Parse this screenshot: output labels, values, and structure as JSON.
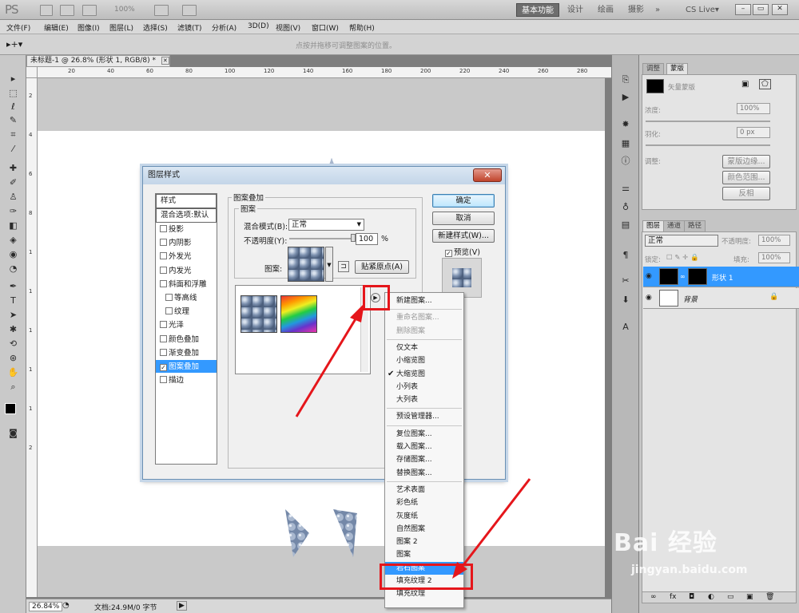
{
  "app": {
    "logo": "PS",
    "zoom": "100%",
    "workspaces": [
      "基本功能",
      "设计",
      "绘画",
      "摄影"
    ],
    "more": "»",
    "cslive": "CS Live▾",
    "window_buttons": [
      "–",
      "▭",
      "✕"
    ]
  },
  "menu": [
    "文件(F)",
    "编辑(E)",
    "图像(I)",
    "图层(L)",
    "选择(S)",
    "滤镜(T)",
    "分析(A)",
    "3D(D)",
    "视图(V)",
    "窗口(W)",
    "帮助(H)"
  ],
  "options_bar": {
    "hint": "点按并拖移可调整图案的位置。"
  },
  "document": {
    "tab_title": "未标题-1 @ 26.8% (形状 1, RGB/8) *",
    "tab_close": "✕",
    "ruler_h": [
      "20",
      "40",
      "60",
      "80",
      "100",
      "120",
      "140",
      "160",
      "180",
      "200",
      "220",
      "240",
      "260",
      "280"
    ],
    "ruler_v": [
      "2",
      "4",
      "6",
      "8",
      "1",
      "1",
      "1",
      "1",
      "1",
      "2"
    ],
    "status_zoom": "26.84%",
    "status_doc": "文档:24.9M/0 字节"
  },
  "dialog": {
    "title": "图层样式",
    "close": "✕",
    "styles_header": "样式",
    "blend_default": "混合选项:默认",
    "styles": [
      {
        "label": "投影",
        "checked": false,
        "indent": false
      },
      {
        "label": "内阴影",
        "checked": false,
        "indent": false
      },
      {
        "label": "外发光",
        "checked": false,
        "indent": false
      },
      {
        "label": "内发光",
        "checked": false,
        "indent": false
      },
      {
        "label": "斜面和浮雕",
        "checked": false,
        "indent": false
      },
      {
        "label": "等高线",
        "checked": false,
        "indent": true
      },
      {
        "label": "纹理",
        "checked": false,
        "indent": true
      },
      {
        "label": "光泽",
        "checked": false,
        "indent": false
      },
      {
        "label": "颜色叠加",
        "checked": false,
        "indent": false
      },
      {
        "label": "渐变叠加",
        "checked": false,
        "indent": false
      },
      {
        "label": "图案叠加",
        "checked": true,
        "indent": false,
        "selected": true
      },
      {
        "label": "描边",
        "checked": false,
        "indent": false
      }
    ],
    "group_title": "图案叠加",
    "subgroup_title": "图案",
    "blend_mode_label": "混合模式(B):",
    "blend_mode_value": "正常",
    "opacity_label": "不透明度(Y):",
    "opacity_value": "100",
    "opacity_unit": "%",
    "opacity_level": 1.0,
    "pattern_label": "图案:",
    "snap_button": "贴紧原点(A)",
    "ok": "确定",
    "cancel": "取消",
    "new_style": "新建样式(W)...",
    "preview_label": "预览(V)",
    "preview_checked": true
  },
  "popup_menu": {
    "groups": [
      [
        {
          "label": "新建图案...",
          "state": "normal"
        }
      ],
      [
        {
          "label": "重命名图案...",
          "state": "disabled"
        },
        {
          "label": "删除图案",
          "state": "disabled"
        }
      ],
      [
        {
          "label": "仅文本",
          "state": "normal"
        },
        {
          "label": "小缩览图",
          "state": "normal"
        },
        {
          "label": "大缩览图",
          "state": "checked"
        },
        {
          "label": "小列表",
          "state": "normal"
        },
        {
          "label": "大列表",
          "state": "normal"
        }
      ],
      [
        {
          "label": "预设管理器...",
          "state": "normal"
        }
      ],
      [
        {
          "label": "复位图案...",
          "state": "normal"
        },
        {
          "label": "载入图案...",
          "state": "normal"
        },
        {
          "label": "存储图案...",
          "state": "normal"
        },
        {
          "label": "替换图案...",
          "state": "normal"
        }
      ],
      [
        {
          "label": "艺术表面",
          "state": "normal"
        },
        {
          "label": "彩色纸",
          "state": "normal"
        },
        {
          "label": "灰度纸",
          "state": "normal"
        },
        {
          "label": "自然图案",
          "state": "normal"
        },
        {
          "label": "图案 2",
          "state": "normal"
        },
        {
          "label": "图案",
          "state": "normal"
        },
        {
          "label": "岩石图案",
          "state": "highlighted"
        },
        {
          "label": "填充纹理 2",
          "state": "normal"
        },
        {
          "label": "填充纹理",
          "state": "normal"
        }
      ]
    ],
    "check_mark": "✔"
  },
  "panels": {
    "top_tabs": [
      "调整",
      "蒙版"
    ],
    "mask_title": "矢量蒙版",
    "density_label": "浓度:",
    "density_value": "100%",
    "feather_label": "羽化:",
    "feather_value": "0 px",
    "refine_label": "调整:",
    "mask_edge": "蒙版边缘...",
    "color_range": "颜色范围...",
    "invert": "反相",
    "layer_tabs": [
      "图层",
      "通道",
      "路径"
    ],
    "blend_mode": "正常",
    "opacity_label": "不透明度:",
    "opacity_value": "100%",
    "lock_label": "锁定:",
    "fill_label": "填充:",
    "fill_value": "100%",
    "layers": [
      {
        "name": "形状 1",
        "selected": true
      },
      {
        "name": "背景",
        "selected": false
      }
    ],
    "bottom_icons": [
      "∞",
      "fx",
      "◘",
      "◐",
      "▭",
      "▣",
      "🗑"
    ]
  },
  "watermark": {
    "brand": "Bai 经验",
    "url": "jingyan.baidu.com"
  },
  "colors": {
    "highlight": "#3399ff",
    "annotation": "#e5161b"
  }
}
